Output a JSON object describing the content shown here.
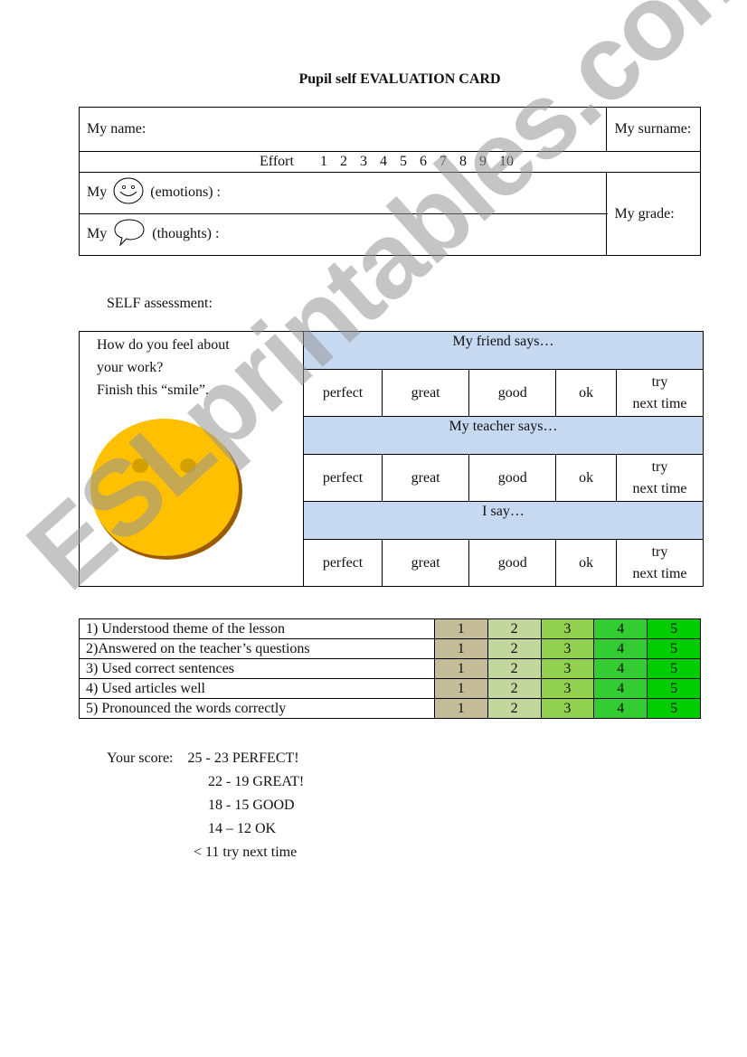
{
  "title": "Pupil self EVALUATION CARD",
  "header": {
    "name_label": "My name:",
    "surname_label": "My surname:",
    "effort_label": "Effort",
    "effort_scale": [
      "1",
      "2",
      "3",
      "4",
      "5",
      "6",
      "7",
      "8",
      "9",
      "10"
    ],
    "emotions_prefix": "My",
    "emotions_icon": "smiley-face-icon",
    "emotions_label": "(emotions) :",
    "thoughts_prefix": "My",
    "thoughts_icon": "speech-bubble-icon",
    "thoughts_label": "(thoughts) :",
    "grade_label": "My grade:"
  },
  "self_assessment": {
    "label": "SELF assessment:",
    "prompt_line1": "How do you feel about",
    "prompt_line2": "your work?",
    "prompt_line3": "Finish this “smile”.",
    "smiley_icon": "blank-smiley-face-icon",
    "smiley_color": "#ffc000",
    "header_color": "#c6d9f1",
    "groups": [
      {
        "heading": "My friend says…",
        "options": [
          "perfect",
          "great",
          "good",
          "ok",
          "try next time"
        ]
      },
      {
        "heading": "My teacher says…",
        "options": [
          "perfect",
          "great",
          "good",
          "ok",
          "try next time"
        ]
      },
      {
        "heading": "I say…",
        "options": [
          "perfect",
          "great",
          "good",
          "ok",
          "try next time"
        ]
      }
    ],
    "try_line1": "try",
    "try_line2": "next time"
  },
  "criteria": {
    "items": [
      "1) Understood theme of the lesson",
      "2)Answered on the teacher’s questions",
      "3) Used correct sentences",
      "4) Used articles well",
      "5) Pronounced the words correctly"
    ],
    "scores": [
      "1",
      "2",
      "3",
      "4",
      "5"
    ],
    "score_colors": [
      "#c4bd97",
      "#c3d69b",
      "#92d050",
      "#33cc33",
      "#00cc00"
    ]
  },
  "score_key": {
    "label": "Your score:",
    "rows": [
      "25 - 23 PERFECT!",
      "22 - 19 GREAT!",
      "18 - 15 GOOD",
      "14 – 12 OK",
      "< 11 try next time"
    ]
  },
  "watermark": "ESLprintables.com"
}
